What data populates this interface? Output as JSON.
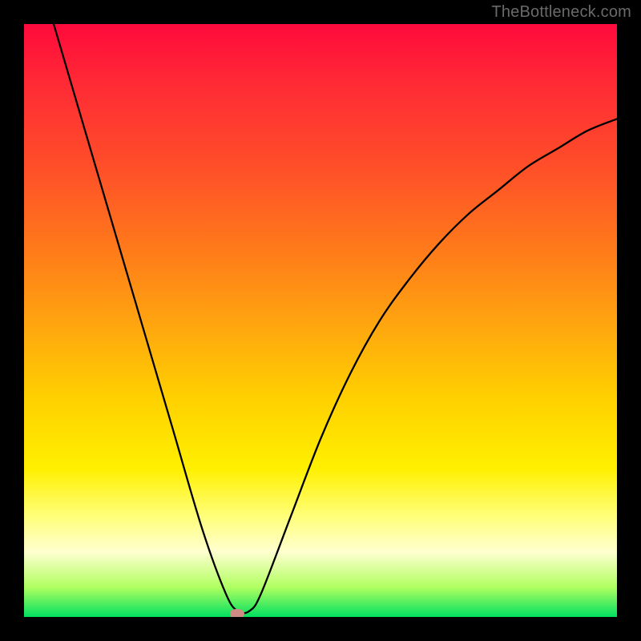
{
  "watermark": "TheBottleneck.com",
  "chart_data": {
    "type": "line",
    "title": "",
    "xlabel": "",
    "ylabel": "",
    "xlim": [
      0,
      100
    ],
    "ylim": [
      0,
      100
    ],
    "series": [
      {
        "name": "bottleneck-curve",
        "x": [
          5,
          10,
          15,
          20,
          25,
          30,
          34,
          36,
          38,
          40,
          45,
          50,
          55,
          60,
          65,
          70,
          75,
          80,
          85,
          90,
          95,
          100
        ],
        "values": [
          100,
          83,
          66,
          49,
          32,
          15,
          4,
          1,
          1,
          4,
          17,
          30,
          41,
          50,
          57,
          63,
          68,
          72,
          76,
          79,
          82,
          84
        ]
      }
    ],
    "marker": {
      "x": 36,
      "y": 0.5
    },
    "gradient_stops": [
      {
        "pos": 0,
        "color": "#ff0a3c"
      },
      {
        "pos": 50,
        "color": "#ffa310"
      },
      {
        "pos": 75,
        "color": "#fff000"
      },
      {
        "pos": 100,
        "color": "#00e060"
      }
    ]
  }
}
